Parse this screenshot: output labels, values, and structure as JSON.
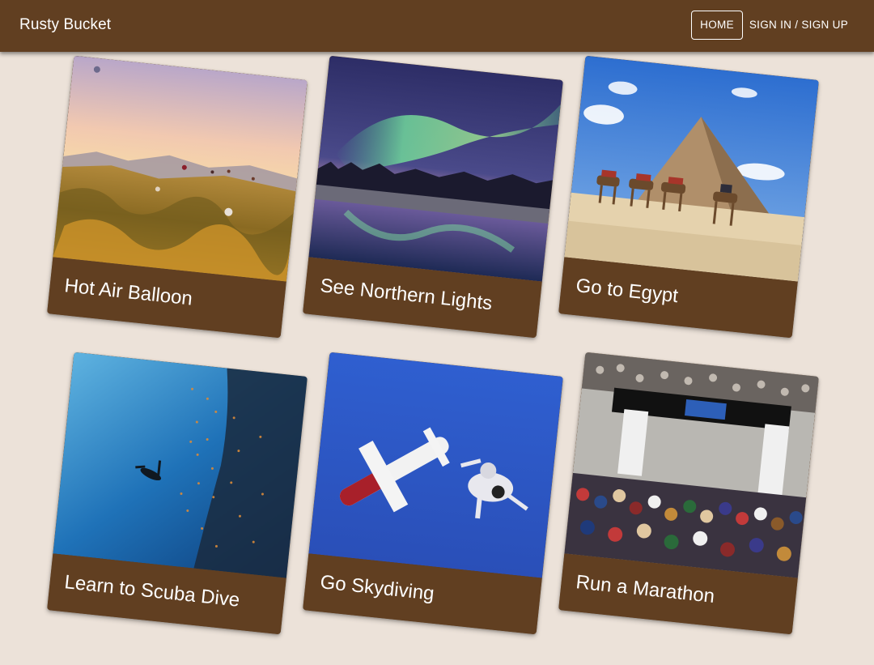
{
  "app": {
    "title": "Rusty Bucket"
  },
  "nav": {
    "home_label": "HOME",
    "signin_label": "SIGN IN / SIGN UP"
  },
  "cards": [
    {
      "title": "Hot Air Balloon"
    },
    {
      "title": "See Northern Lights"
    },
    {
      "title": "Go to Egypt"
    },
    {
      "title": "Learn to Scuba Dive"
    },
    {
      "title": "Go Skydiving"
    },
    {
      "title": "Run a Marathon"
    }
  ],
  "colors": {
    "appbar": "#613f21",
    "background": "#ece2d9",
    "caption": "#613f21",
    "text": "#ffffff"
  }
}
